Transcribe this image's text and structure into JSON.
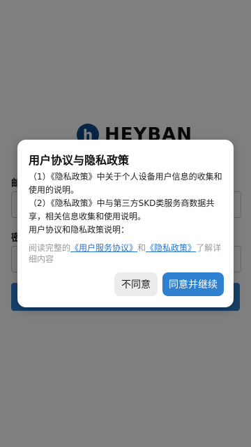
{
  "background": {
    "logo_letter": "h",
    "logo_text": "HEYBAN",
    "email_label_partial": "邮",
    "password_label_partial": "密"
  },
  "dialog": {
    "title": "用户协议与隐私政策",
    "paragraphs": [
      "（1）《隐私政策》中关于个人设备用户信息的收集和使用的说明。",
      "（2）《隐私政策》中与第三方SKD类服务商数据共享，相关信息收集和使用说明。",
      "用户协议和隐私政策说明："
    ],
    "agreement_text": {
      "prefix": "阅读完整的",
      "terms_link": "《用户服务协议》",
      "middle": "和",
      "privacy_link": "《隐私政策》",
      "suffix": "了解详细内容"
    },
    "buttons": {
      "disagree": "不同意",
      "agree": "同意并继续"
    }
  },
  "colors": {
    "primary": "#2f80cf",
    "link": "#2a76c9",
    "overlay": "rgba(0,0,0,0.5)"
  }
}
